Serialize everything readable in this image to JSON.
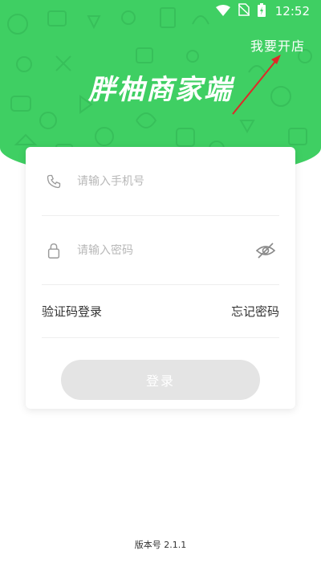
{
  "status_bar": {
    "time": "12:52"
  },
  "header": {
    "open_shop_label": "我要开店",
    "brand_title": "胖柚商家端",
    "background_color": "#3fcf63"
  },
  "login_form": {
    "phone_placeholder": "请输入手机号",
    "password_placeholder": "请输入密码",
    "sms_login_label": "验证码登录",
    "forgot_password_label": "忘记密码",
    "login_button_label": "登录"
  },
  "footer": {
    "version_text": "版本号 2.1.1"
  },
  "icons": [
    "wifi-icon",
    "no-sim-icon",
    "battery-icon",
    "phone-icon",
    "lock-icon",
    "eye-off-icon"
  ]
}
